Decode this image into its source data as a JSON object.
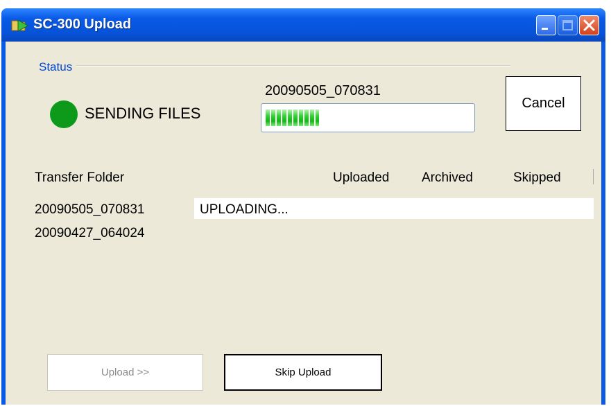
{
  "window": {
    "title": "SC-300 Upload"
  },
  "status": {
    "group_label": "Status",
    "state_text": "SENDING FILES",
    "indicator_color": "#0d9a1a",
    "current_folder": "20090505_070831",
    "progress_fraction": 0.26,
    "cancel_label": "Cancel"
  },
  "transfer_list": {
    "columns": [
      "Transfer Folder",
      "Uploaded",
      "Archived",
      "Skipped"
    ],
    "rows": [
      {
        "folder": "20090505_070831",
        "status": "UPLOADING..."
      },
      {
        "folder": "20090427_064024",
        "status": ""
      }
    ]
  },
  "buttons": {
    "upload_label": "Upload >>",
    "skip_label": "Skip Upload"
  },
  "colors": {
    "titlebar": "#0a5ae6",
    "client_bg": "#ece9d8",
    "accent_text": "#0046d5",
    "close_button": "#d3411d"
  }
}
